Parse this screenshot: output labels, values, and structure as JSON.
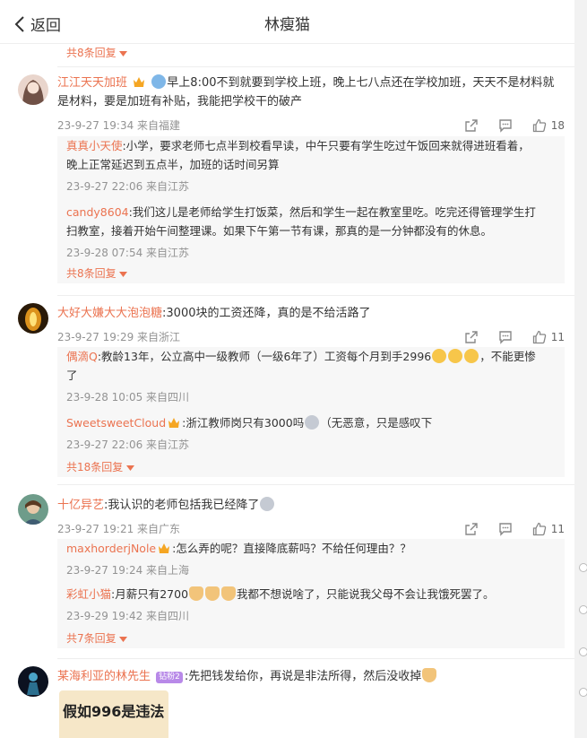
{
  "header": {
    "back_label": "返回",
    "title": "林瘦猫"
  },
  "top_more": "共8条回复",
  "comments": [
    {
      "user": "江江天天加班",
      "text1": "早上8:00不到就要到学校上班，晚上七八点还在学校加班，天天不是材料就",
      "text2": "是材料，要是加班有补贴，我能把学校干的破产",
      "meta": "23-9-27 19:34 来自福建",
      "likes": "18",
      "replies": [
        {
          "user": "真真小天使",
          "text1": ":小学，要求老师七点半到校看早读，中午只要有学生吃过午饭回来就得进班看着，",
          "text2": "晚上正常延迟到五点半，加班的话时间另算",
          "meta": "23-9-27 22:06 来自江苏"
        },
        {
          "user": "candy8604",
          "text1": ":我们这儿是老师给学生打饭菜，然后和学生一起在教室里吃。吃完还得管理学生打",
          "text2": "扫教室，接着开始午间整理课。如果下午第一节有课，那真的是一分钟都没有的休息。",
          "meta": "23-9-28 07:54 来自江苏"
        }
      ],
      "more": "共8条回复"
    },
    {
      "user": "大好大嫌大大泡泡糖",
      "text1": ":3000块的工资还降，真的是不给活路了",
      "meta": "23-9-27 19:29 来自浙江",
      "likes": "11",
      "replies": [
        {
          "user": "偶滴Q",
          "text1": ":教龄13年，公立高中一级教师（一级6年了）工资每个月到手2996",
          "text1b": "，不能更惨",
          "text2": "了",
          "meta": "23-9-28 10:05 来自四川"
        },
        {
          "user": "SweetsweetCloud",
          "text1": ":浙江教师岗只有3000吗",
          "text1b": "（无恶意，只是感叹下",
          "meta": "23-9-27 22:06 来自江苏"
        }
      ],
      "more": "共18条回复"
    },
    {
      "user": "十亿异艺",
      "text1": ":我认识的老师包括我已经降了",
      "meta": "23-9-27 19:21 来自广东",
      "likes": "11",
      "replies": [
        {
          "user": "maxhorderjNole",
          "text1": ":怎么弄的呢？直接降底薪吗？不给任何理由？？",
          "meta": "23-9-27 19:24 来自上海"
        },
        {
          "user": "彩虹小猫",
          "text1": ":月薪只有2700",
          "text1b": "我都不想说啥了，只能说我父母不会让我饿死罢了。",
          "meta": "23-9-29 19:42 来自四川"
        }
      ],
      "more": "共7条回复"
    },
    {
      "user": "某海利亚的林先生",
      "badge": "钻粉2",
      "text1": ":先把钱发给你，再说是非法所得，然后没收掉"
    }
  ],
  "image_preview_text": "假如996是违法",
  "icons": {
    "share": "share-icon",
    "comment": "comment-icon",
    "like": "like-icon"
  },
  "colors": {
    "accent": "#eb7350",
    "meta": "#939393",
    "reply_bg": "#f7f7f7"
  }
}
